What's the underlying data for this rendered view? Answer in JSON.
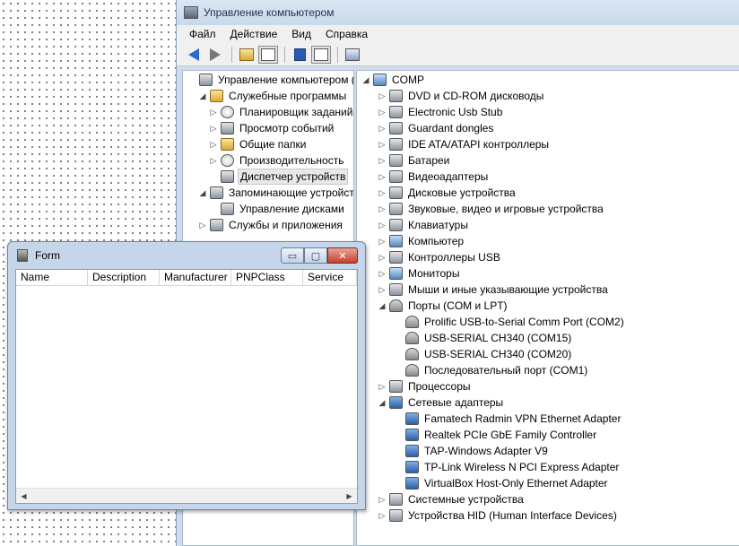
{
  "mmc": {
    "title": "Управление компьютером",
    "menu": [
      "Файл",
      "Действие",
      "Вид",
      "Справка"
    ],
    "toolbar_icons": [
      "back-arrow-icon",
      "forward-arrow-icon",
      "up-folder-icon",
      "show-hide-tree-icon",
      "help-icon",
      "properties-icon",
      "scan-hardware-icon"
    ]
  },
  "left_tree": [
    {
      "label": "Управление компьютером (л",
      "level": 0,
      "expander": "",
      "icon": "computer-management-icon"
    },
    {
      "label": "Служебные программы",
      "level": 1,
      "expander": "◢",
      "icon": "tools-icon"
    },
    {
      "label": "Планировщик заданий",
      "level": 2,
      "expander": "▷",
      "icon": "clock-icon"
    },
    {
      "label": "Просмотр событий",
      "level": 2,
      "expander": "▷",
      "icon": "event-viewer-icon"
    },
    {
      "label": "Общие папки",
      "level": 2,
      "expander": "▷",
      "icon": "shared-folder-icon"
    },
    {
      "label": "Производительность",
      "level": 2,
      "expander": "▷",
      "icon": "performance-icon"
    },
    {
      "label": "Диспетчер устройств",
      "level": 2,
      "expander": "",
      "icon": "device-manager-icon",
      "selected": true
    },
    {
      "label": "Запоминающие устройст",
      "level": 1,
      "expander": "◢",
      "icon": "storage-icon"
    },
    {
      "label": "Управление дисками",
      "level": 2,
      "expander": "",
      "icon": "disk-management-icon"
    },
    {
      "label": "Службы и приложения",
      "level": 1,
      "expander": "▷",
      "icon": "services-icon"
    }
  ],
  "device_tree": [
    {
      "label": "COMP",
      "level": 0,
      "expander": "◢",
      "icon": "computer-icon"
    },
    {
      "label": "DVD и CD-ROM дисководы",
      "level": 1,
      "expander": "▷",
      "icon": "dvd-drive-icon"
    },
    {
      "label": "Electronic Usb Stub",
      "level": 1,
      "expander": "▷",
      "icon": "usb-stub-icon"
    },
    {
      "label": "Guardant dongles",
      "level": 1,
      "expander": "▷",
      "icon": "dongle-icon"
    },
    {
      "label": "IDE ATA/ATAPI контроллеры",
      "level": 1,
      "expander": "▷",
      "icon": "ide-controller-icon"
    },
    {
      "label": "Батареи",
      "level": 1,
      "expander": "▷",
      "icon": "battery-icon"
    },
    {
      "label": "Видеоадаптеры",
      "level": 1,
      "expander": "▷",
      "icon": "display-adapter-icon"
    },
    {
      "label": "Дисковые устройства",
      "level": 1,
      "expander": "▷",
      "icon": "disk-drive-icon"
    },
    {
      "label": "Звуковые, видео и игровые устройства",
      "level": 1,
      "expander": "▷",
      "icon": "sound-icon"
    },
    {
      "label": "Клавиатуры",
      "level": 1,
      "expander": "▷",
      "icon": "keyboard-icon"
    },
    {
      "label": "Компьютер",
      "level": 1,
      "expander": "▷",
      "icon": "computer-icon"
    },
    {
      "label": "Контроллеры USB",
      "level": 1,
      "expander": "▷",
      "icon": "usb-controller-icon"
    },
    {
      "label": "Мониторы",
      "level": 1,
      "expander": "▷",
      "icon": "monitor-icon"
    },
    {
      "label": "Мыши и иные указывающие устройства",
      "level": 1,
      "expander": "▷",
      "icon": "mouse-icon"
    },
    {
      "label": "Порты (COM и LPT)",
      "level": 1,
      "expander": "◢",
      "icon": "port-icon"
    },
    {
      "label": "Prolific USB-to-Serial Comm Port (COM2)",
      "level": 2,
      "expander": "",
      "icon": "port-icon"
    },
    {
      "label": "USB-SERIAL CH340 (COM15)",
      "level": 2,
      "expander": "",
      "icon": "port-icon"
    },
    {
      "label": "USB-SERIAL CH340 (COM20)",
      "level": 2,
      "expander": "",
      "icon": "port-icon"
    },
    {
      "label": "Последовательный порт (COM1)",
      "level": 2,
      "expander": "",
      "icon": "port-icon"
    },
    {
      "label": "Процессоры",
      "level": 1,
      "expander": "▷",
      "icon": "processor-icon"
    },
    {
      "label": "Сетевые адаптеры",
      "level": 1,
      "expander": "◢",
      "icon": "network-adapter-icon"
    },
    {
      "label": "Famatech Radmin VPN Ethernet Adapter",
      "level": 2,
      "expander": "",
      "icon": "network-adapter-icon"
    },
    {
      "label": "Realtek PCIe GbE Family Controller",
      "level": 2,
      "expander": "",
      "icon": "network-adapter-icon"
    },
    {
      "label": "TAP-Windows Adapter V9",
      "level": 2,
      "expander": "",
      "icon": "network-adapter-icon"
    },
    {
      "label": "TP-Link Wireless N PCI Express Adapter",
      "level": 2,
      "expander": "",
      "icon": "network-adapter-disabled-icon"
    },
    {
      "label": "VirtualBox Host-Only Ethernet Adapter",
      "level": 2,
      "expander": "",
      "icon": "network-adapter-icon"
    },
    {
      "label": "Системные устройства",
      "level": 1,
      "expander": "▷",
      "icon": "system-devices-icon"
    },
    {
      "label": "Устройства HID (Human Interface Devices)",
      "level": 1,
      "expander": "▷",
      "icon": "hid-icon"
    }
  ],
  "form": {
    "title": "Form",
    "columns": [
      "Name",
      "Description",
      "Manufacturer",
      "PNPClass",
      "Service"
    ],
    "buttons": {
      "minimize": "▭",
      "maximize": "▢",
      "close": "✕"
    },
    "scroll_left": "◀",
    "scroll_right": "▶"
  }
}
